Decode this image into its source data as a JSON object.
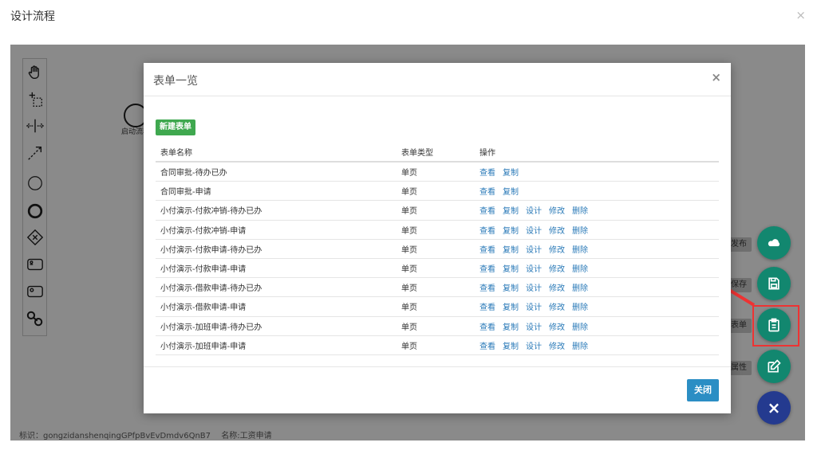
{
  "page": {
    "title": "设计流程",
    "close": "×"
  },
  "canvas": {
    "start_label": "启动流程",
    "status": {
      "id": "标识：gongzidanshenqingGPfpBvEvDmdv6QnB7",
      "name": "名称:工资申请"
    }
  },
  "palette": {
    "tools": [
      "hand-tool-icon",
      "lasso-tool-icon",
      "space-tool-icon",
      "connect-tool-icon",
      "start-event-icon",
      "end-event-icon",
      "gateway-icon",
      "user-task-icon",
      "service-task-icon",
      "connection-icon"
    ]
  },
  "fab": {
    "labels": {
      "publish": "发布",
      "save": "保存",
      "form": "表单",
      "props": "属性"
    },
    "colors": {
      "green": "#12876f",
      "navy": "#243a8f",
      "highlight": "#e33333"
    }
  },
  "modal": {
    "title": "表单一览",
    "close": "×",
    "new_button": "新建表单",
    "columns": {
      "name": "表单名称",
      "type": "表单类型",
      "actions": "操作"
    },
    "actions": {
      "view": "查看",
      "copy": "复制",
      "design": "设计",
      "edit": "修改",
      "delete": "删除"
    },
    "rows": [
      {
        "name": "合同审批-待办已办",
        "type": "单页",
        "actions": [
          "查看",
          "复制"
        ]
      },
      {
        "name": "合同审批-申请",
        "type": "单页",
        "actions": [
          "查看",
          "复制"
        ]
      },
      {
        "name": "小付演示-付款冲销-待办已办",
        "type": "单页",
        "actions": [
          "查看",
          "复制",
          "设计",
          "修改",
          "删除"
        ]
      },
      {
        "name": "小付演示-付款冲销-申请",
        "type": "单页",
        "actions": [
          "查看",
          "复制",
          "设计",
          "修改",
          "删除"
        ]
      },
      {
        "name": "小付演示-付款申请-待办已办",
        "type": "单页",
        "actions": [
          "查看",
          "复制",
          "设计",
          "修改",
          "删除"
        ]
      },
      {
        "name": "小付演示-付款申请-申请",
        "type": "单页",
        "actions": [
          "查看",
          "复制",
          "设计",
          "修改",
          "删除"
        ]
      },
      {
        "name": "小付演示-借款申请-待办已办",
        "type": "单页",
        "actions": [
          "查看",
          "复制",
          "设计",
          "修改",
          "删除"
        ]
      },
      {
        "name": "小付演示-借款申请-申请",
        "type": "单页",
        "actions": [
          "查看",
          "复制",
          "设计",
          "修改",
          "删除"
        ]
      },
      {
        "name": "小付演示-加班申请-待办已办",
        "type": "单页",
        "actions": [
          "查看",
          "复制",
          "设计",
          "修改",
          "删除"
        ]
      },
      {
        "name": "小付演示-加班申请-申请",
        "type": "单页",
        "actions": [
          "查看",
          "复制",
          "设计",
          "修改",
          "删除"
        ]
      }
    ],
    "close_button": "关闭"
  }
}
